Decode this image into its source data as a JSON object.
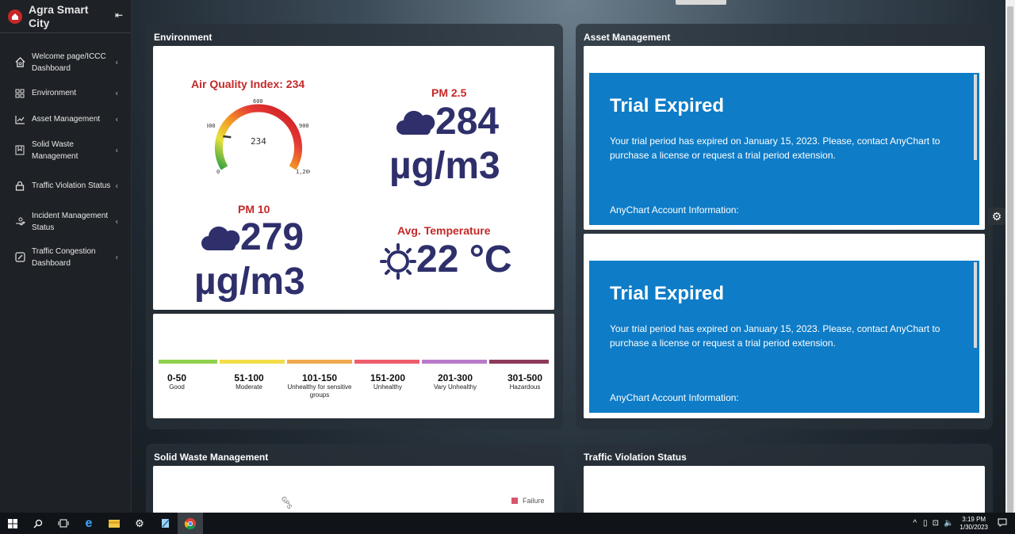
{
  "app": {
    "title": "Agra Smart City"
  },
  "sidebar": {
    "items": [
      {
        "label": "Welcome page/ICCC Dashboard",
        "icon": "home-gear-icon"
      },
      {
        "label": "Environment",
        "icon": "grid-icon"
      },
      {
        "label": "Asset Management",
        "icon": "chart-line-icon"
      },
      {
        "label": "Solid Waste Management",
        "icon": "bookmark-box-icon"
      },
      {
        "label": "Traffic Violation Status",
        "icon": "lock-icon"
      },
      {
        "label": "Incident Management Status",
        "icon": "hand-icon"
      },
      {
        "label": "Traffic Congestion Dashboard",
        "icon": "gauge-icon"
      }
    ]
  },
  "environment": {
    "title": "Environment",
    "aqi_label": "Air Quality Index: 234",
    "gauge": {
      "value": "234",
      "ticks": [
        "0",
        "300",
        "600",
        "900",
        "1,200"
      ],
      "fraction": 0.195
    },
    "pm25": {
      "label": "PM 2.5",
      "value": "284",
      "unit": "µg/m3"
    },
    "pm10": {
      "label": "PM 10",
      "value": "279",
      "unit": "µg/m3"
    },
    "temp": {
      "label": "Avg. Temperature",
      "value": "22 °C"
    },
    "legend": [
      {
        "range": "0-50",
        "desc": "Good",
        "color": "#8fd14f"
      },
      {
        "range": "51-100",
        "desc": "Moderate",
        "color": "#f2dd48"
      },
      {
        "range": "101-150",
        "desc": "Unhealthy for sensitive groups",
        "color": "#f1a94e"
      },
      {
        "range": "151-200",
        "desc": "Unhealthy",
        "color": "#ee5d6c"
      },
      {
        "range": "201-300",
        "desc": "Vary Unhealthy",
        "color": "#b97bc9"
      },
      {
        "range": "301-500",
        "desc": "Hazardous",
        "color": "#8e3a59"
      }
    ]
  },
  "asset_management": {
    "title": "Asset Management",
    "trial": {
      "heading": "Trial Expired",
      "message": "Your trial period has expired on January 15, 2023. Please, contact AnyChart to purchase a license or request a trial period extension.",
      "account": "AnyChart Account Information:"
    }
  },
  "solid_waste": {
    "title": "Solid Waste Management",
    "legend_label": "Failure",
    "axis_fragment": "GPS"
  },
  "traffic_violation": {
    "title": "Traffic Violation Status"
  },
  "taskbar": {
    "time": "3:19 PM",
    "date": "1/30/2023"
  }
}
